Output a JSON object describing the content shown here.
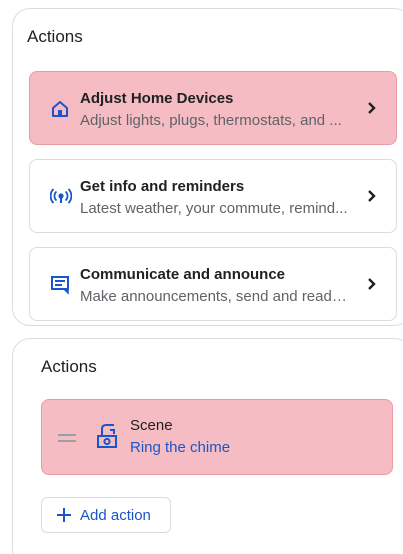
{
  "top_panel": {
    "title": "Actions",
    "items": [
      {
        "title": "Adjust Home Devices",
        "subtitle": "Adjust lights, plugs, thermostats, and ...",
        "icon": "home-icon",
        "highlighted": true
      },
      {
        "title": "Get info and reminders",
        "subtitle": "Latest weather, your commute, remind...",
        "icon": "broadcast-icon",
        "highlighted": false
      },
      {
        "title": "Communicate and announce",
        "subtitle": "Make announcements, send and read t...",
        "icon": "announce-icon",
        "highlighted": false
      }
    ]
  },
  "bottom_panel": {
    "title": "Actions",
    "scene": {
      "title": "Scene",
      "subtitle": "Ring the chime",
      "icon": "scene-icon"
    },
    "add_action_label": "Add action"
  },
  "colors": {
    "highlight": "#f6bcc3",
    "accent": "#1a56c9",
    "icon_blue": "#1a56c9",
    "border": "#dadce0"
  }
}
